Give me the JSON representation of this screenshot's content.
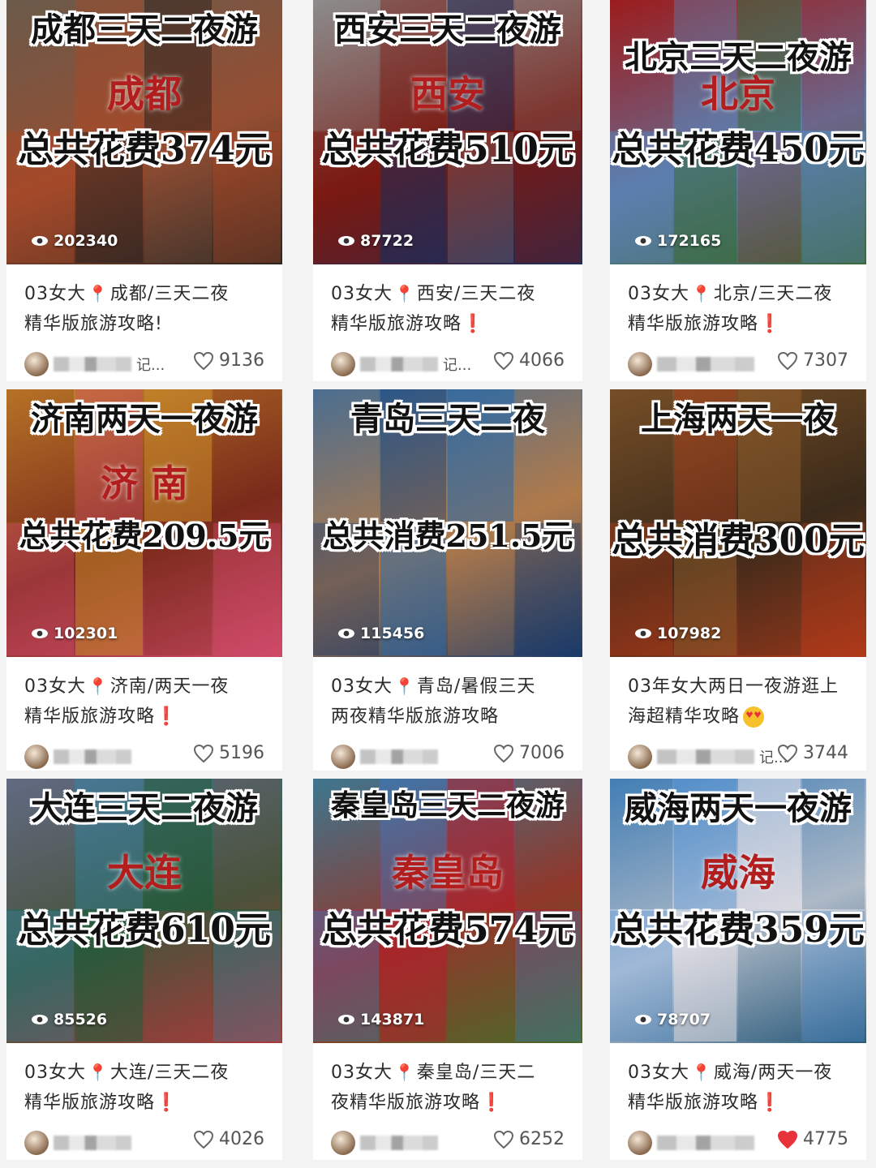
{
  "colors": {
    "accent_red": "#e5322d",
    "like_red": "#e8333b"
  },
  "cards": [
    {
      "cover_title": "成都三天二夜游",
      "cover_name": "成都",
      "cover_cost": "总共花费374元",
      "views": "202340",
      "title_prefix": "03女大",
      "title_rest": "成都/三天二夜",
      "title_line2": "精华版旅游攻略!",
      "title_mark": "",
      "author": "记...",
      "likes": "9136",
      "liked": false,
      "palette": [
        "#6a5a4a",
        "#a44a2a",
        "#2b2420"
      ]
    },
    {
      "cover_title": "西安三天二夜游",
      "cover_name": "西安",
      "cover_cost": "总共花费510元",
      "views": "87722",
      "title_prefix": "03女大",
      "title_rest": "西安/三天二夜",
      "title_line2": "精华版旅游攻略",
      "title_mark": "❗",
      "author": "记...",
      "likes": "4066",
      "liked": false,
      "palette": [
        "#8c8c8c",
        "#7a1a12",
        "#1c2c5a"
      ]
    },
    {
      "cover_title": "北京三天二夜游",
      "cover_name": "北京",
      "cover_cost": "总共花费450元",
      "views": "172165",
      "title_prefix": "03女大",
      "title_rest": "北京/三天二夜",
      "title_line2": "精华版旅游攻略",
      "title_mark": "❗",
      "author": "",
      "likes": "7307",
      "liked": false,
      "palette": [
        "#9b1d1d",
        "#5c7fb0",
        "#3a6a3a"
      ]
    },
    {
      "cover_title": "济南两天一夜游",
      "cover_name": "济 南",
      "cover_cost": "总共花费209.5元",
      "views": "102301",
      "title_prefix": "03女大",
      "title_rest": "济南/两天一夜",
      "title_line2": "精华版旅游攻略",
      "title_mark": "❗",
      "author": "",
      "likes": "5196",
      "liked": false,
      "palette": [
        "#c98a2a",
        "#7a2a1a",
        "#d04a6a"
      ]
    },
    {
      "cover_title": "青岛三天二夜",
      "cover_name": "",
      "cover_cost": "总共消费251.5元",
      "views": "115456",
      "title_prefix": "03女大",
      "title_rest": "青岛/暑假三天",
      "title_line2": "两夜精华版旅游攻略",
      "title_mark": "",
      "author": "",
      "likes": "7006",
      "liked": false,
      "palette": [
        "#2a6aa8",
        "#b07a4a",
        "#1a3a6a"
      ]
    },
    {
      "cover_title": "上海两天一夜",
      "cover_name": "",
      "cover_cost": "总共消费300元",
      "views": "107982",
      "title_prefix": "",
      "title_rest": "03年女大两日一夜游逛上",
      "title_line2": "海超精华攻略",
      "title_mark": "emoji",
      "author": "记...",
      "likes": "3744",
      "liked": false,
      "palette": [
        "#8a5a2a",
        "#3a2a1a",
        "#b03a1a"
      ]
    },
    {
      "cover_title": "大连三天二夜游",
      "cover_name": "大连",
      "cover_cost": "总共花费610元",
      "views": "85526",
      "title_prefix": "03女大",
      "title_rest": "大连/三天二夜",
      "title_line2": "精华版旅游攻略",
      "title_mark": "❗",
      "author": "",
      "likes": "4026",
      "liked": false,
      "palette": [
        "#4a7a9a",
        "#2a5a3a",
        "#a83a3a"
      ]
    },
    {
      "cover_title": "秦皇岛三天二夜游",
      "cover_name": "秦皇岛",
      "cover_cost": "总共花费574元",
      "views": "143871",
      "title_prefix": "03女大",
      "title_rest": "秦皇岛/三天二",
      "title_line2": "夜精华版旅游攻略",
      "title_mark": "❗",
      "author": "",
      "likes": "6252",
      "liked": false,
      "palette": [
        "#3a7ab0",
        "#a8262a",
        "#4a6a2a"
      ]
    },
    {
      "cover_title": "威海两天一夜游",
      "cover_name": "威海",
      "cover_cost": "总共花费359元",
      "views": "78707",
      "title_prefix": "03女大",
      "title_rest": "威海/两天一夜",
      "title_line2": "精华版旅游攻略",
      "title_mark": "❗",
      "author": "",
      "likes": "4775",
      "liked": true,
      "palette": [
        "#4a8ac8",
        "#d8d8e0",
        "#2a5a7a"
      ]
    }
  ]
}
